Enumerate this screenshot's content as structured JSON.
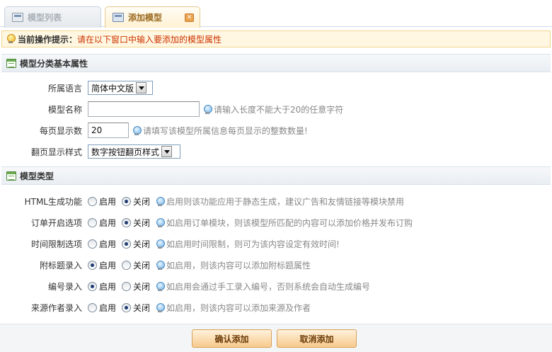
{
  "tabs": [
    {
      "label": "模型列表"
    },
    {
      "label": "添加模型"
    }
  ],
  "tip": {
    "label": "当前操作提示：",
    "text": "请在以下窗口中输入要添加的模型属性"
  },
  "section_basic": {
    "title": "模型分类基本属性",
    "language": {
      "label": "所属语言",
      "value": "简体中文版"
    },
    "name": {
      "label": "模型名称",
      "value": "",
      "hint": "请输入长度不能大于20的任意字符"
    },
    "per_page": {
      "label": "每页显示数",
      "value": "20",
      "hint": "请填写该模型所属信息每页显示的整数数量!"
    },
    "paging_style": {
      "label": "翻页显示样式",
      "value": "数字按钮翻页样式"
    }
  },
  "section_type": {
    "title": "模型类型",
    "enable_label": "启用",
    "disable_label": "关闭",
    "options": [
      {
        "label": "HTML生成功能",
        "selected": "关闭",
        "hint": "启用则该功能应用于静态生成，建议广告和友情链接等模块禁用"
      },
      {
        "label": "订单开启选项",
        "selected": "关闭",
        "hint": "如启用订单模块，则该模型所匹配的内容可以添加价格并发布订购"
      },
      {
        "label": "时间限制选项",
        "selected": "关闭",
        "hint": "如启用时间限制，则可为该内容设定有效时间!"
      },
      {
        "label": "附标题录入",
        "selected": "启用",
        "hint": "如启用，则该内容可以添加附标题属性"
      },
      {
        "label": "编号录入",
        "selected": "启用",
        "hint": "如启用会通过手工录入编号，否则系统会自动生成编号"
      },
      {
        "label": "来源作者录入",
        "selected": "关闭",
        "hint": "如启用，则该内容可以添加来源及作者"
      }
    ]
  },
  "buttons": {
    "confirm": "确认添加",
    "cancel": "取消添加"
  }
}
